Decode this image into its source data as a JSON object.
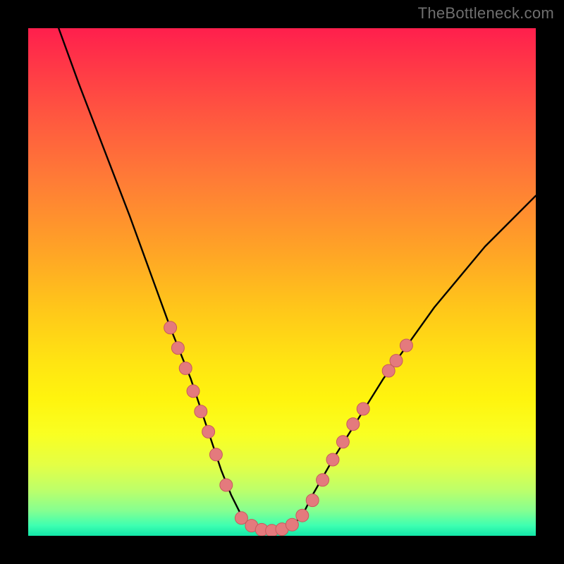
{
  "watermark": "TheBottleneck.com",
  "chart_data": {
    "type": "line",
    "title": "",
    "xlabel": "",
    "ylabel": "",
    "xlim": [
      0,
      100
    ],
    "ylim": [
      0,
      100
    ],
    "grid": false,
    "legend": false,
    "series": [
      {
        "name": "curve",
        "x": [
          6,
          10,
          15,
          20,
          24,
          28,
          30,
          32,
          34,
          36,
          38,
          40,
          42,
          44,
          46,
          48,
          50,
          52,
          54,
          56,
          60,
          65,
          70,
          75,
          80,
          85,
          90,
          95,
          100
        ],
        "y": [
          100,
          89,
          76,
          63,
          52,
          41,
          36,
          31,
          25,
          19,
          13,
          8,
          4,
          2,
          1,
          1,
          1,
          2,
          4,
          8,
          15,
          23,
          31,
          38,
          45,
          51,
          57,
          62,
          67
        ]
      }
    ],
    "markers": [
      {
        "name": "left-marker",
        "x": 28.0,
        "y": 41.0
      },
      {
        "name": "left-marker",
        "x": 29.5,
        "y": 37.0
      },
      {
        "name": "left-marker",
        "x": 31.0,
        "y": 33.0
      },
      {
        "name": "left-marker",
        "x": 32.5,
        "y": 28.5
      },
      {
        "name": "left-marker",
        "x": 34.0,
        "y": 24.5
      },
      {
        "name": "left-marker",
        "x": 35.5,
        "y": 20.5
      },
      {
        "name": "left-marker",
        "x": 37.0,
        "y": 16.0
      },
      {
        "name": "left-marker",
        "x": 39.0,
        "y": 10.0
      },
      {
        "name": "floor-marker",
        "x": 42.0,
        "y": 3.5
      },
      {
        "name": "floor-marker",
        "x": 44.0,
        "y": 2.0
      },
      {
        "name": "floor-marker",
        "x": 46.0,
        "y": 1.2
      },
      {
        "name": "floor-marker",
        "x": 48.0,
        "y": 1.0
      },
      {
        "name": "floor-marker",
        "x": 50.0,
        "y": 1.3
      },
      {
        "name": "floor-marker",
        "x": 52.0,
        "y": 2.2
      },
      {
        "name": "floor-marker",
        "x": 54.0,
        "y": 4.0
      },
      {
        "name": "floor-marker",
        "x": 56.0,
        "y": 7.0
      },
      {
        "name": "right-marker",
        "x": 58.0,
        "y": 11.0
      },
      {
        "name": "right-marker",
        "x": 60.0,
        "y": 15.0
      },
      {
        "name": "right-marker",
        "x": 62.0,
        "y": 18.5
      },
      {
        "name": "right-marker",
        "x": 64.0,
        "y": 22.0
      },
      {
        "name": "right-marker",
        "x": 66.0,
        "y": 25.0
      },
      {
        "name": "right-marker",
        "x": 71.0,
        "y": 32.5
      },
      {
        "name": "right-marker",
        "x": 72.5,
        "y": 34.5
      },
      {
        "name": "right-marker",
        "x": 74.5,
        "y": 37.5
      }
    ],
    "colors": {
      "curve": "#000000",
      "marker_fill": "#e47a7d",
      "marker_stroke": "#c75a5d"
    }
  }
}
